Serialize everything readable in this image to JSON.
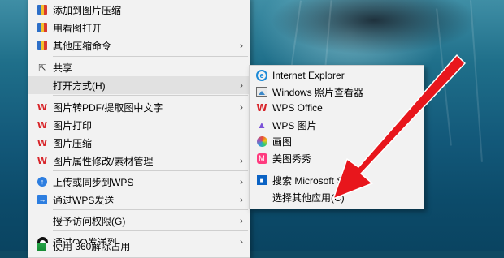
{
  "context_menu": {
    "items": [
      {
        "label": "添加到图片压缩",
        "icon": "zip-icon"
      },
      {
        "label": "用看图打开",
        "icon": "zip-icon"
      },
      {
        "label": "其他压缩命令",
        "icon": "zip-icon",
        "submenu": true
      },
      {
        "label": "共享",
        "icon": "share-icon"
      },
      {
        "label": "打开方式(H)",
        "icon": "",
        "submenu": true,
        "highlighted": true
      },
      {
        "label": "图片转PDF/提取图中文字",
        "icon": "wps-icon",
        "submenu": true
      },
      {
        "label": "图片打印",
        "icon": "wps-icon"
      },
      {
        "label": "图片压缩",
        "icon": "wps-icon"
      },
      {
        "label": "图片属性修改/素材管理",
        "icon": "wps-icon",
        "submenu": true
      },
      {
        "label": "上传或同步到WPS",
        "icon": "upload-icon",
        "submenu": true
      },
      {
        "label": "通过WPS发送",
        "icon": "send-icon",
        "submenu": true
      },
      {
        "label": "授予访问权限(G)",
        "icon": "",
        "submenu": true
      },
      {
        "label": "通过QQ发送到",
        "icon": "qq-icon",
        "submenu": true
      },
      {
        "label": "使用 360解除占用",
        "icon": "360-icon"
      }
    ]
  },
  "open_with_submenu": {
    "items": [
      {
        "label": "Internet Explorer",
        "icon": "internet-explorer-icon"
      },
      {
        "label": "Windows 照片查看器",
        "icon": "photo-viewer-icon"
      },
      {
        "label": "WPS Office",
        "icon": "wps-office-icon"
      },
      {
        "label": "WPS 图片",
        "icon": "wps-picture-icon"
      },
      {
        "label": "画图",
        "icon": "paint-icon"
      },
      {
        "label": "美图秀秀",
        "icon": "meitu-icon"
      },
      {
        "label": "搜索 Microsoft Store",
        "icon": "store-icon"
      },
      {
        "label": "选择其他应用(C)",
        "icon": ""
      }
    ]
  },
  "glyphs": {
    "chevron": "›",
    "wps": "W",
    "ie": "e",
    "wps_picture": "▲",
    "meitu": "M",
    "store": "■",
    "share": "⇱",
    "upload": "↑",
    "send": "→"
  },
  "colors": {
    "menu_bg": "#f2f2f2",
    "highlight_bg": "#e1e1e1",
    "arrow": "#e8161c",
    "wps_red": "#d8262b"
  }
}
